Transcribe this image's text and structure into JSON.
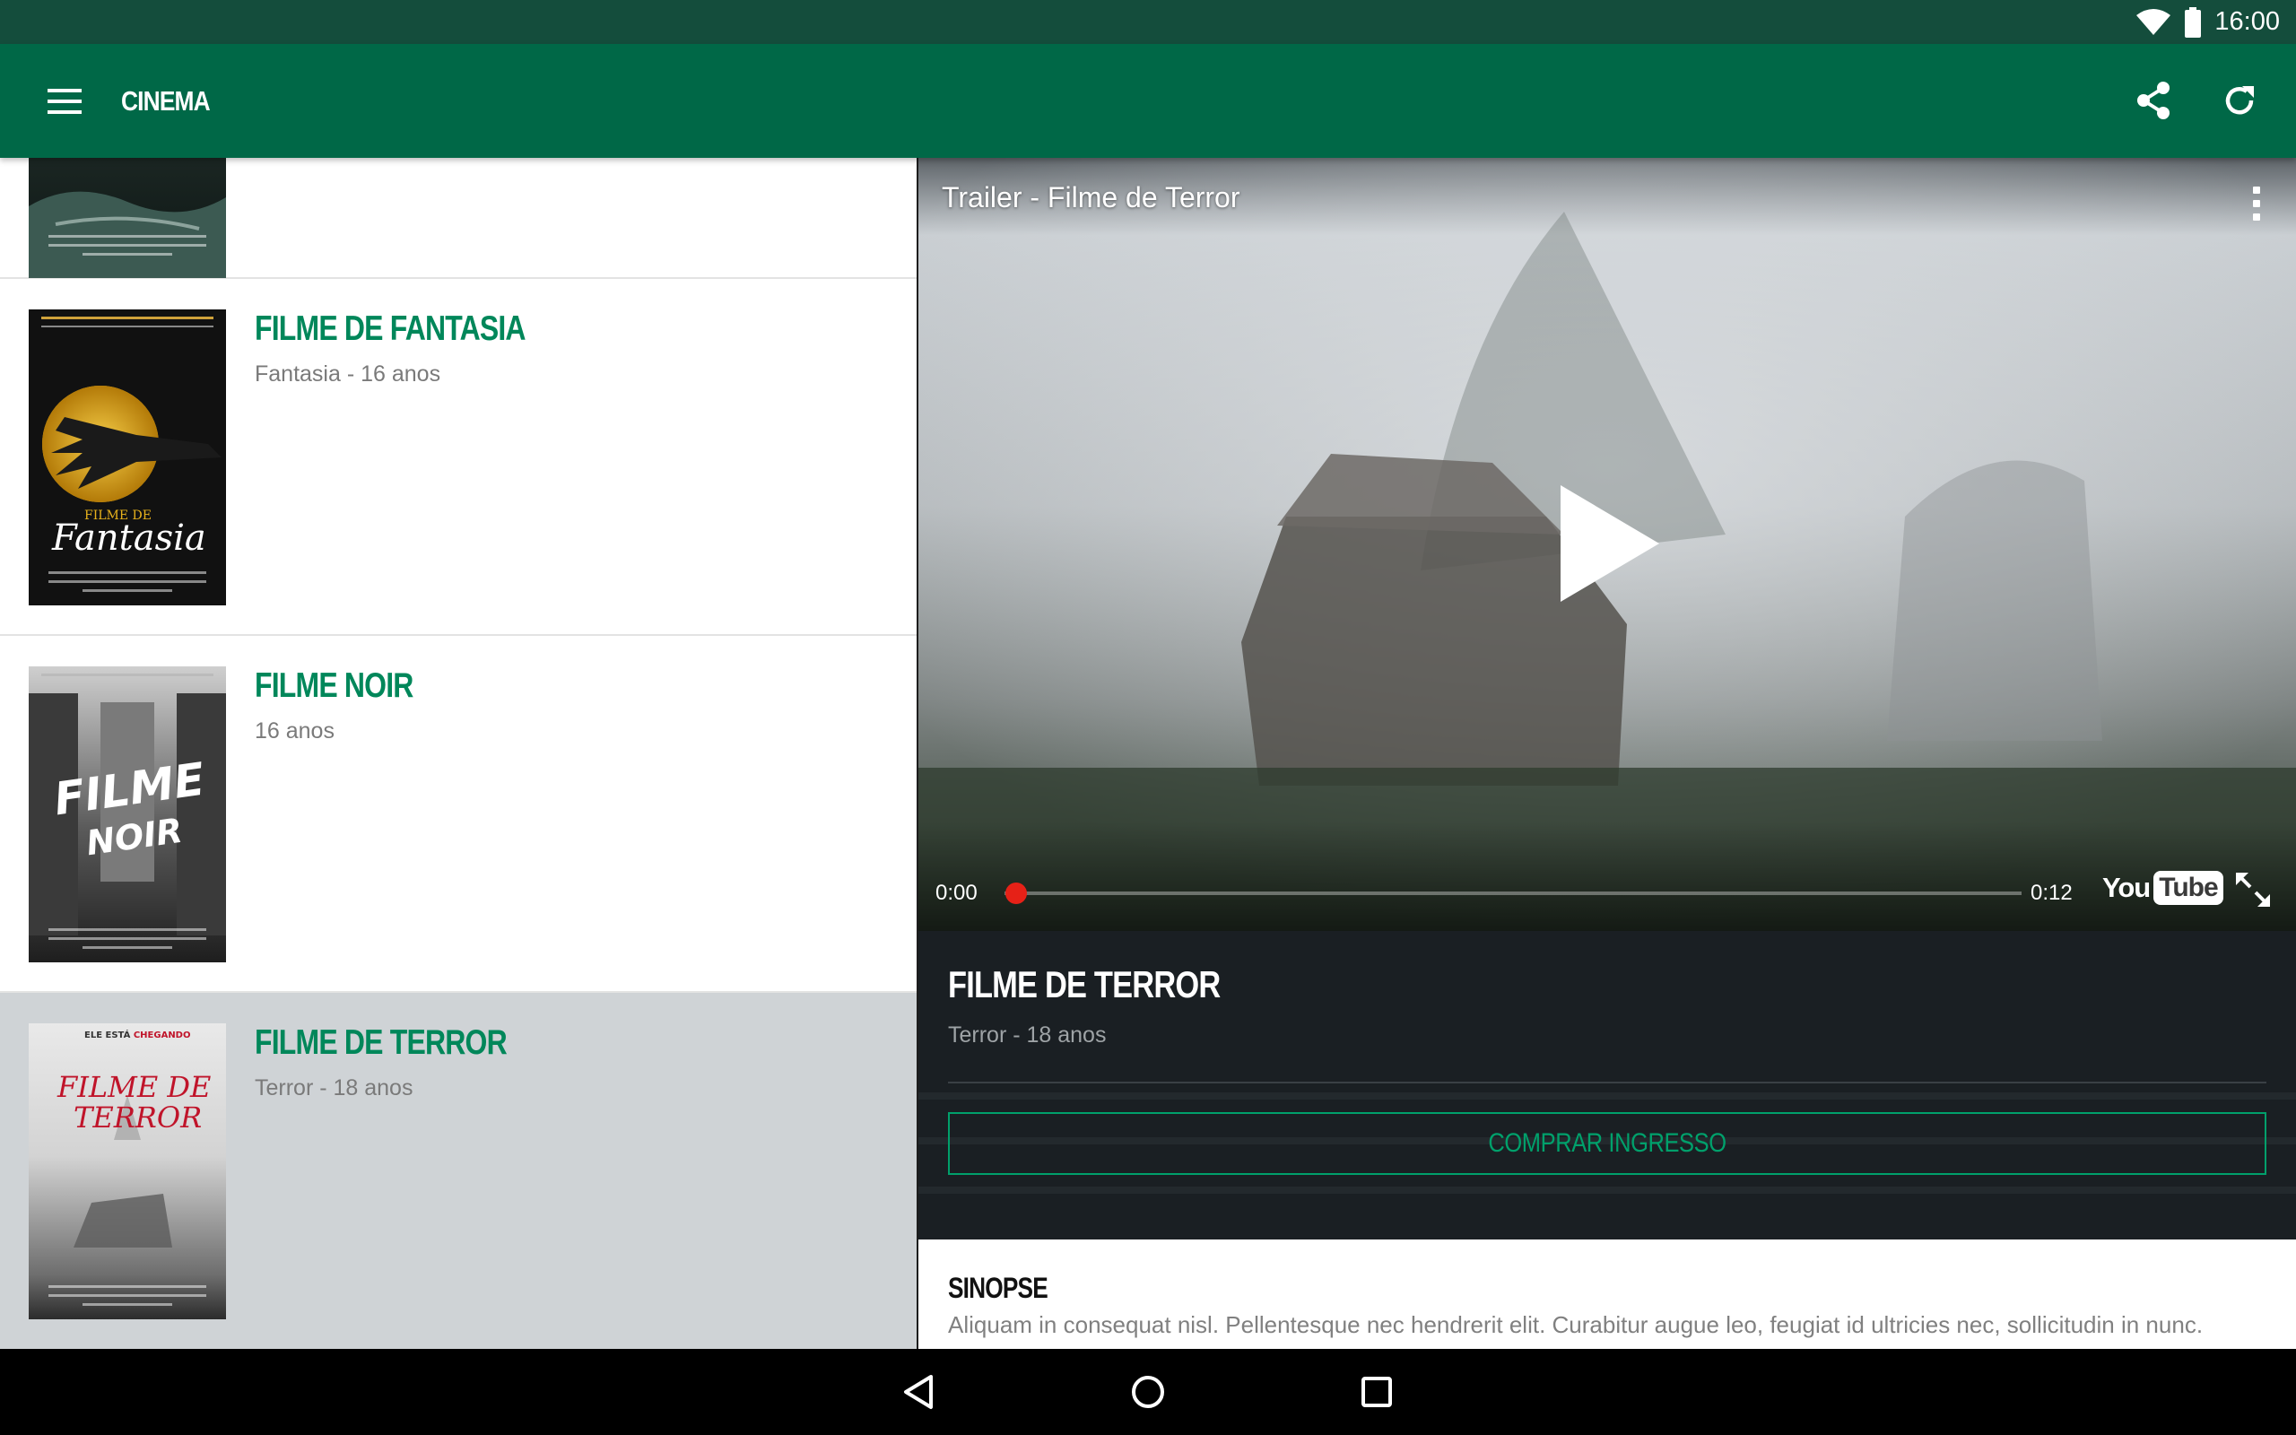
{
  "status_bar": {
    "time": "16:00"
  },
  "app_bar": {
    "title": "CINEMA"
  },
  "movies": [
    {
      "title": "FILME DE FANTASIA",
      "subtitle": "Fantasia - 16 anos",
      "poster_text": "Fantasia",
      "poster_small": "FILME DE"
    },
    {
      "title": "FILME NOIR",
      "subtitle": "16 anos",
      "poster_text": "FILME",
      "poster_text2": "NOIR"
    },
    {
      "title": "FILME DE TERROR",
      "subtitle": "Terror - 18 anos",
      "poster_top": "ELE ESTÁ",
      "poster_top_accent": "CHEGANDO",
      "poster_text": "FILME DE",
      "poster_text2": "TERROR"
    }
  ],
  "player": {
    "title": "Trailer - Filme de Terror",
    "current_time": "0:00",
    "duration": "0:12",
    "progress": 0.0,
    "logo_you": "You",
    "logo_tube": "Tube"
  },
  "detail": {
    "title": "FILME DE TERROR",
    "subtitle": "Terror - 18 anos",
    "buy_label": "COMPRAR INGRESSO",
    "synopsis_title": "SINOPSE",
    "synopsis_text": "Aliquam in consequat nisl. Pellentesque nec hendrerit elit. Curabitur augue leo, feugiat id ultricies nec, sollicitudin in nunc."
  },
  "colors": {
    "primary": "#006847",
    "status": "#144d3c",
    "accent": "#00875a",
    "progress": "#e62117"
  }
}
